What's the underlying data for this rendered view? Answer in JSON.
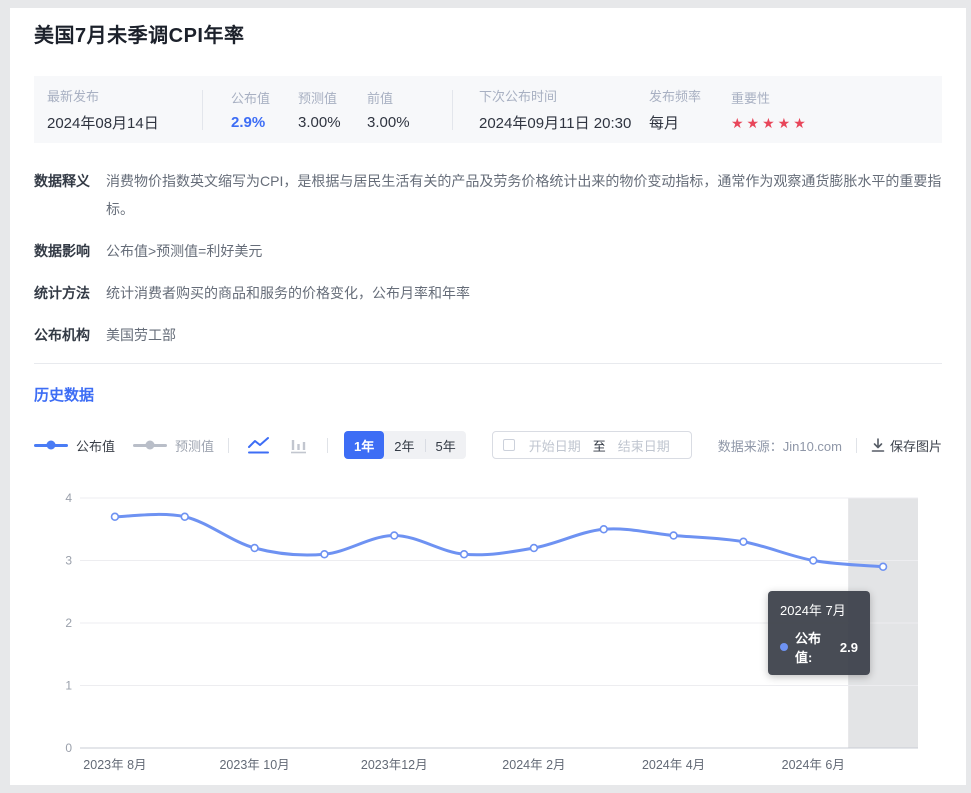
{
  "page": {
    "title": "美国7月未季调CPI年率"
  },
  "summary": {
    "latest_label": "最新发布",
    "latest_value": "2024年08月14日",
    "published_label": "公布值",
    "published_value": "2.9%",
    "forecast_label": "预测值",
    "forecast_value": "3.00%",
    "previous_label": "前值",
    "previous_value": "3.00%",
    "next_label": "下次公布时间",
    "next_value": "2024年09月11日 20:30",
    "frequency_label": "发布频率",
    "frequency_value": "每月",
    "importance_label": "重要性",
    "importance_stars": "★★★★★"
  },
  "details": [
    {
      "label": "数据释义",
      "text": "消费物价指数英文缩写为CPI，是根据与居民生活有关的产品及劳务价格统计出来的物价变动指标，通常作为观察通货膨胀水平的重要指标。"
    },
    {
      "label": "数据影响",
      "text": "公布值>预测值=利好美元"
    },
    {
      "label": "统计方法",
      "text": "统计消费者购买的商品和服务的价格变化，公布月率和年率"
    },
    {
      "label": "公布机构",
      "text": "美国劳工部"
    }
  ],
  "history": {
    "heading": "历史数据"
  },
  "controls": {
    "legend": [
      {
        "label": "公布值",
        "active": true
      },
      {
        "label": "预测值",
        "active": false
      }
    ],
    "range_tabs": [
      {
        "label": "1年",
        "active": true
      },
      {
        "label": "2年",
        "active": false
      },
      {
        "label": "5年",
        "active": false
      }
    ],
    "date_start_placeholder": "开始日期",
    "date_to": "至",
    "date_end_placeholder": "结束日期",
    "source": "数据来源：Jin10.com",
    "save_image": "保存图片"
  },
  "tooltip": {
    "title": "2024年 7月",
    "label": "公布值:",
    "value": "2.9"
  },
  "chart_data": {
    "type": "line",
    "categories": [
      "2023年8月",
      "2023年9月",
      "2023年10月",
      "2023年11月",
      "2023年12月",
      "2024年1月",
      "2024年2月",
      "2024年3月",
      "2024年4月",
      "2024年5月",
      "2024年6月",
      "2024年7月"
    ],
    "series": [
      {
        "name": "公布值",
        "values": [
          3.7,
          3.7,
          3.2,
          3.1,
          3.4,
          3.1,
          3.2,
          3.5,
          3.4,
          3.3,
          3.0,
          2.9
        ]
      }
    ],
    "xtick_indices": [
      0,
      2,
      4,
      6,
      8,
      10
    ],
    "xtick_labels": [
      "2023年 8月",
      "2023年 10月",
      "2023年12月",
      "2024年 2月",
      "2024年 4月",
      "2024年 6月"
    ],
    "ylim": [
      0,
      4
    ],
    "yticks": [
      0,
      1,
      2,
      3,
      4
    ],
    "grid": true,
    "legend_position": "top-left",
    "highlight_index": 11
  },
  "colors": {
    "accent": "#3d6df5",
    "line": "#6e92f2",
    "star": "#e8465a",
    "band": "#e3e4e6",
    "grid": "#ededf0",
    "axis": "#c9ccd4",
    "ytick": "#9aa0ab",
    "xtick": "#636a76",
    "tooltip_bg": "#3a3e48"
  }
}
